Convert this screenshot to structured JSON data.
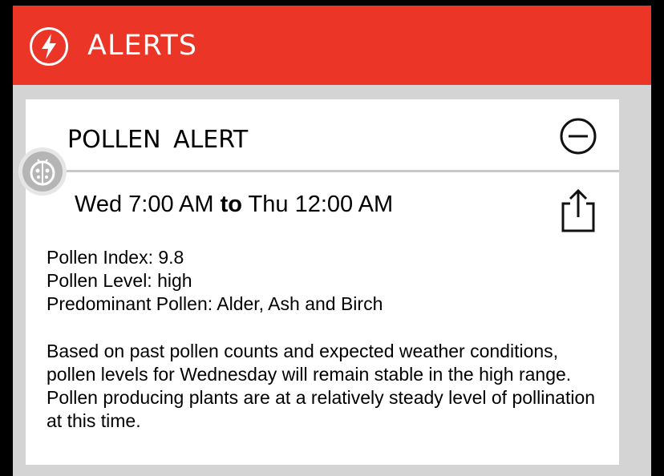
{
  "header": {
    "title": "ALERTS",
    "icon": "lightning-bolt-icon",
    "background_color": "#eb3627"
  },
  "alert": {
    "title": "POLLEN  ALERT",
    "collapse_icon": "minus-circle-icon",
    "share_icon": "share-icon",
    "badge_icon": "allergy-badge-icon",
    "time_start": "Wed 7:00 AM",
    "time_separator": "to",
    "time_end": "Thu 12:00 AM",
    "details": [
      "Pollen Index: 9.8",
      "Pollen Level: high",
      "Predominant Pollen: Alder, Ash and Birch"
    ],
    "description": "Based on past pollen counts and expected weather conditions, pollen levels for Wednesday will remain stable in the high range. Pollen producing plants are at a relatively steady level of pollination at this time."
  }
}
